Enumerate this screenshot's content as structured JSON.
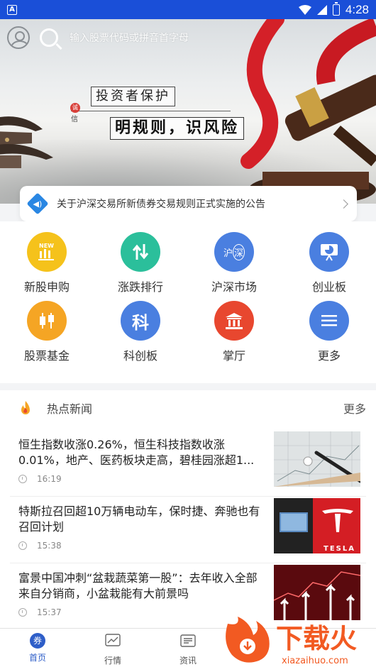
{
  "status_bar": {
    "time": "4:28",
    "app_badge": "A"
  },
  "header": {
    "search_placeholder": "输入股票代码或拼音首字母"
  },
  "banner": {
    "tag": "投资者保护",
    "seal": "诚",
    "seal_sub": "信",
    "slogan": "明规则，识风险"
  },
  "notice": {
    "text": "关于沪深交易所新债券交易规则正式实施的公告"
  },
  "grid": [
    {
      "label": "新股申购",
      "icon": "new-stock-icon",
      "color": "#f5c21b",
      "badge": "NEW"
    },
    {
      "label": "涨跌排行",
      "icon": "rank-arrows-icon",
      "color": "#2bbf9b"
    },
    {
      "label": "沪深市场",
      "icon": "sh-sz-market-icon",
      "color": "#4a7fe0",
      "glyph_a": "沪",
      "glyph_b": "深"
    },
    {
      "label": "创业板",
      "icon": "chart-board-icon",
      "color": "#4a7fe0"
    },
    {
      "label": "股票基金",
      "icon": "candlestick-icon",
      "color": "#f5a524"
    },
    {
      "label": "科创板",
      "icon": "sci-tech-icon",
      "color": "#4a7fe0",
      "glyph": "科"
    },
    {
      "label": "掌厅",
      "icon": "bank-hall-icon",
      "color": "#e8472f"
    },
    {
      "label": "更多",
      "icon": "menu-icon",
      "color": "#4a7fe0"
    }
  ],
  "news": {
    "title": "热点新闻",
    "more": "更多",
    "items": [
      {
        "text": "恒生指数收涨0.26%，恒生科技指数收涨0.01%，地产、医药板块走高，碧桂园涨超1...",
        "time": "16:19",
        "thumb": "pen-chart-photo"
      },
      {
        "text": "特斯拉召回超10万辆电动车，保时捷、奔驰也有召回计划",
        "time": "15:38",
        "thumb": "tesla-photo"
      },
      {
        "text": "富景中国冲刺“盆栽蔬菜第一股”：去年收入全部来自分销商，小盆栽能有大前景吗",
        "time": "15:37",
        "thumb": "stock-arrows-photo"
      }
    ]
  },
  "bottom_nav": [
    {
      "label": "首页",
      "icon": "home-coin-icon",
      "active": true,
      "glyph": "券"
    },
    {
      "label": "行情",
      "icon": "market-chart-icon",
      "active": false
    },
    {
      "label": "资讯",
      "icon": "news-doc-icon",
      "active": false
    }
  ],
  "watermark": {
    "brand": "下载火",
    "url": "xiazaihuo.com"
  },
  "colors": {
    "status_bar": "#1a4fd8",
    "accent": "#2e5ec8"
  }
}
